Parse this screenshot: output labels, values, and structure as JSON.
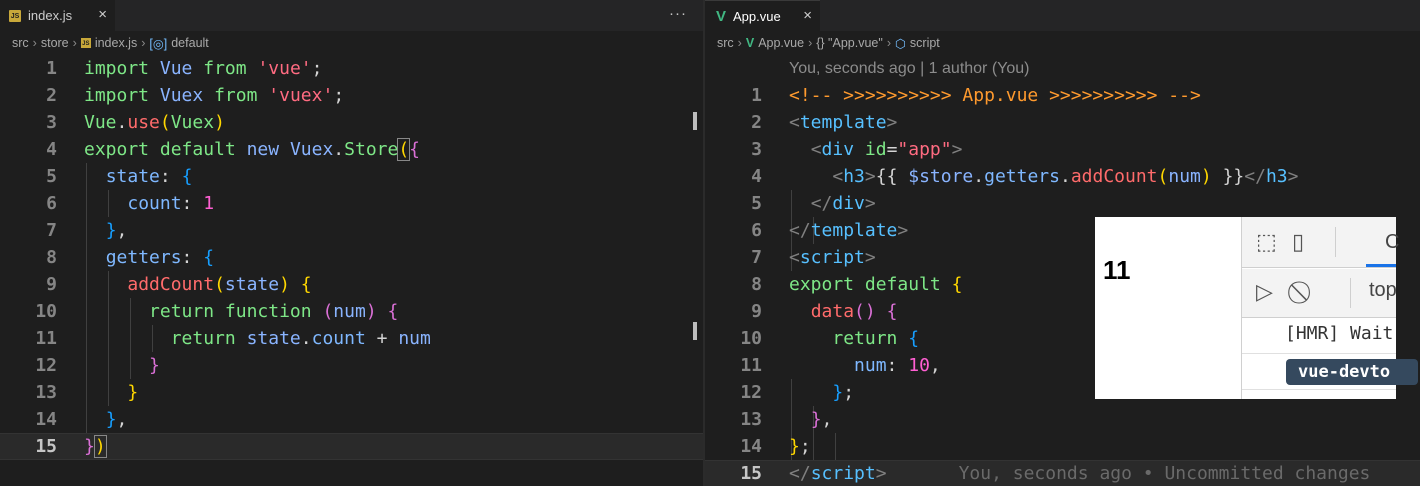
{
  "left": {
    "tab": {
      "icon": "js-file-icon",
      "label": "index.js",
      "close": "×"
    },
    "more": "···",
    "breadcrumb": [
      "src",
      "store",
      "index.js",
      "default"
    ],
    "lines": [
      "1",
      "2",
      "3",
      "4",
      "5",
      "6",
      "7",
      "8",
      "9",
      "10",
      "11",
      "12",
      "13",
      "14",
      "15"
    ],
    "code": {
      "l1": [
        "import",
        " ",
        "Vue",
        " ",
        "from",
        " ",
        "'vue'",
        ";"
      ],
      "l2": [
        "import",
        " ",
        "Vuex",
        " ",
        "from",
        " ",
        "'vuex'",
        ";"
      ],
      "l3": [
        "Vue",
        ".",
        "use",
        "(",
        "Vuex",
        ")"
      ],
      "l4": [
        "export",
        " ",
        "default",
        " ",
        "new",
        " ",
        "Vuex",
        ".",
        "Store",
        "(",
        "{"
      ],
      "l5": [
        "state",
        ": ",
        "{"
      ],
      "l6": [
        "count",
        ": ",
        "1"
      ],
      "l7": [
        "}",
        ","
      ],
      "l8": [
        "getters",
        ": ",
        "{"
      ],
      "l9": [
        "addCount",
        "(",
        "state",
        ")",
        " ",
        "{"
      ],
      "l10": [
        "return",
        " ",
        "function",
        " ",
        "(",
        "num",
        ")",
        " ",
        "{"
      ],
      "l11": [
        "return",
        " ",
        "state",
        ".",
        "count",
        " + ",
        "num"
      ],
      "l12": [
        "}"
      ],
      "l13": [
        "}"
      ],
      "l14": [
        "}",
        ","
      ],
      "l15": [
        "}",
        ")"
      ]
    }
  },
  "right": {
    "tab": {
      "icon": "vue-file-icon",
      "label": "App.vue",
      "close": "×"
    },
    "breadcrumb": [
      "src",
      "App.vue",
      "{} \"App.vue\"",
      "script"
    ],
    "blame_header": "You, seconds ago | 1 author (You)",
    "lines": [
      "1",
      "2",
      "3",
      "4",
      "5",
      "6",
      "7",
      "8",
      "9",
      "10",
      "11",
      "12",
      "13",
      "14",
      "15"
    ],
    "code": {
      "l1": "<!-- >>>>>>>>>> App.vue >>>>>>>>>> -->",
      "l2": [
        "<",
        "template",
        ">"
      ],
      "l3": [
        "<",
        "div",
        " ",
        "id",
        "=",
        "\"app\"",
        ">"
      ],
      "l4": [
        "<",
        "h3",
        ">",
        "{{ ",
        "$store",
        ".",
        "getters",
        ".",
        "addCount",
        "(",
        "num",
        ")",
        " }}",
        "</",
        "h3",
        ">"
      ],
      "l5": [
        "</",
        "div",
        ">"
      ],
      "l6": [
        "</",
        "template",
        ">"
      ],
      "l7": [
        "<",
        "script",
        ">"
      ],
      "l8": [
        "export",
        " ",
        "default",
        " ",
        "{"
      ],
      "l9": [
        "data",
        "(",
        ")",
        " ",
        "{"
      ],
      "l10": [
        "return",
        " ",
        "{"
      ],
      "l11": [
        "num",
        ": ",
        "10",
        ","
      ],
      "l12": [
        "}",
        ";"
      ],
      "l13": [
        "}",
        ","
      ],
      "l14": [
        "}",
        ";"
      ],
      "l15": [
        "</",
        "script",
        ">"
      ]
    },
    "inline_blame": "You, seconds ago • Uncommitted changes"
  },
  "overlay": {
    "preview_value": "11",
    "devtools": {
      "tab_partial": "C",
      "context_partial": "top",
      "log_partial": "[HMR] Wait",
      "badge_partial": "vue-devto",
      "icons": [
        "inspect-element-icon",
        "device-toolbar-icon",
        "show-console-sidebar-icon",
        "clear-console-icon"
      ]
    }
  }
}
